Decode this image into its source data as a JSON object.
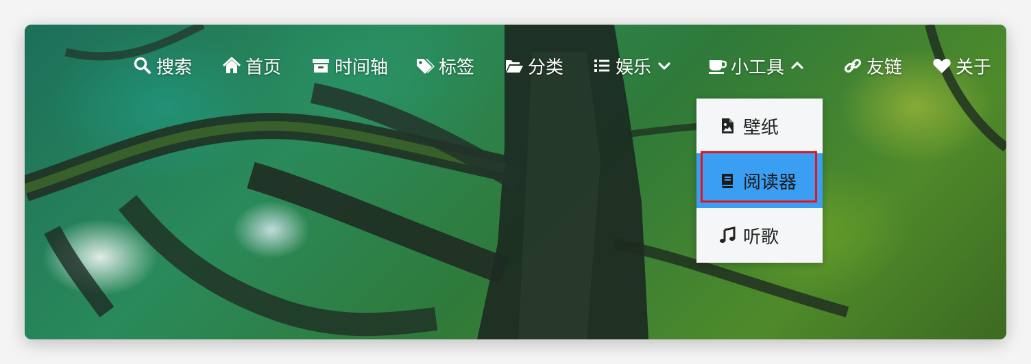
{
  "nav": {
    "items": [
      {
        "label": "搜索",
        "icon": "search-icon"
      },
      {
        "label": "首页",
        "icon": "home-icon"
      },
      {
        "label": "时间轴",
        "icon": "archive-icon"
      },
      {
        "label": "标签",
        "icon": "tags-icon"
      },
      {
        "label": "分类",
        "icon": "folder-open-icon"
      },
      {
        "label": "娱乐",
        "icon": "list-icon",
        "chevron": "chevron-down-icon"
      },
      {
        "label": "小工具",
        "icon": "coffee-icon",
        "chevron": "chevron-up-icon"
      },
      {
        "label": "友链",
        "icon": "link-icon"
      },
      {
        "label": "关于",
        "icon": "heart-icon"
      }
    ]
  },
  "dropdown": {
    "items": [
      {
        "label": "壁纸",
        "icon": "image-file-icon"
      },
      {
        "label": "阅读器",
        "icon": "book-icon",
        "active": true
      },
      {
        "label": "听歌",
        "icon": "music-icon"
      }
    ],
    "active_color": "#3a9ef3",
    "highlight_color": "#e8121a"
  }
}
